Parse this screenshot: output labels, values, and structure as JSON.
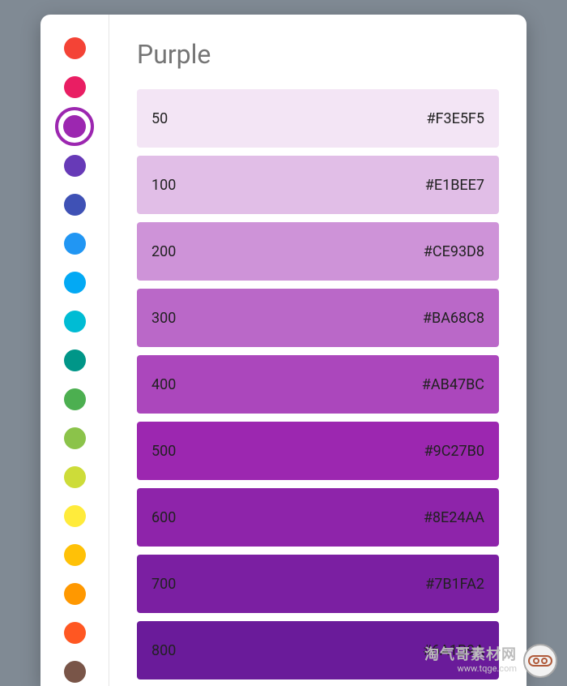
{
  "title": "Purple",
  "selected_index": 2,
  "sidebar": [
    {
      "color": "#F44336"
    },
    {
      "color": "#E91E63"
    },
    {
      "color": "#9C27B0"
    },
    {
      "color": "#673AB7"
    },
    {
      "color": "#3F51B5"
    },
    {
      "color": "#2196F3"
    },
    {
      "color": "#03A9F4"
    },
    {
      "color": "#00BCD4"
    },
    {
      "color": "#009688"
    },
    {
      "color": "#4CAF50"
    },
    {
      "color": "#8BC34A"
    },
    {
      "color": "#CDDC39"
    },
    {
      "color": "#FFEB3B"
    },
    {
      "color": "#FFC107"
    },
    {
      "color": "#FF9800"
    },
    {
      "color": "#FF5722"
    },
    {
      "color": "#795548"
    }
  ],
  "shades": [
    {
      "label": "50",
      "hex": "#F3E5F5",
      "bg": "#F3E5F5",
      "text": "dark"
    },
    {
      "label": "100",
      "hex": "#E1BEE7",
      "bg": "#E1BEE7",
      "text": "dark"
    },
    {
      "label": "200",
      "hex": "#CE93D8",
      "bg": "#CE93D8",
      "text": "dark"
    },
    {
      "label": "300",
      "hex": "#BA68C8",
      "bg": "#BA68C8",
      "text": "dark"
    },
    {
      "label": "400",
      "hex": "#AB47BC",
      "bg": "#AB47BC",
      "text": "dark"
    },
    {
      "label": "500",
      "hex": "#9C27B0",
      "bg": "#9C27B0",
      "text": "dark"
    },
    {
      "label": "600",
      "hex": "#8E24AA",
      "bg": "#8E24AA",
      "text": "dark"
    },
    {
      "label": "700",
      "hex": "#7B1FA2",
      "bg": "#7B1FA2",
      "text": "dark"
    },
    {
      "label": "800",
      "hex": "#6A1B9A",
      "bg": "#6A1B9A",
      "text": "dark"
    }
  ],
  "watermark": {
    "title": "淘气哥素材网",
    "sub": "www.tqge.com"
  }
}
